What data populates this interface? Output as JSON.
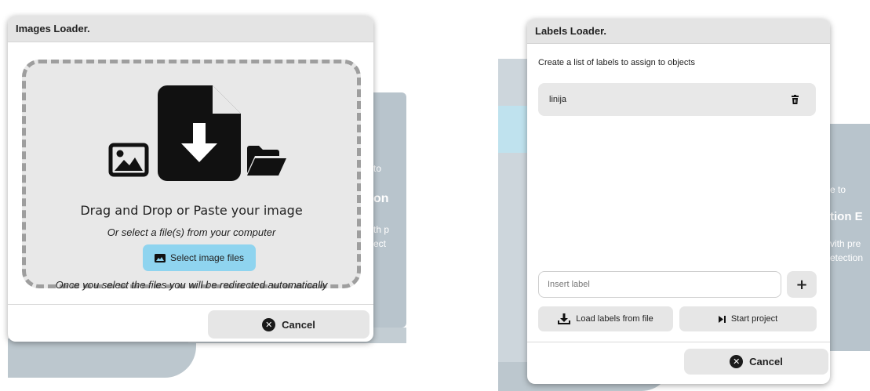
{
  "background": {
    "left_snippets": [
      "to",
      "on",
      "th p",
      "ect"
    ],
    "right_snippets": [
      "e to",
      "tion E",
      "vith pre",
      "etection"
    ]
  },
  "images_loader": {
    "title": "Images Loader.",
    "drop_title": "Drag and Drop or Paste your image",
    "drop_subtitle": "Or select a file(s) from your computer",
    "select_label": "Select image files",
    "note": "Once you select the files you will be redirected automatically",
    "cancel_label": "Cancel"
  },
  "labels_loader": {
    "title": "Labels Loader.",
    "description": "Create a list of labels to assign to objects",
    "labels": [
      "linija"
    ],
    "insert_placeholder": "Insert label",
    "add_label": "+",
    "load_label": "Load labels from file",
    "start_label": "Start project",
    "cancel_label": "Cancel"
  },
  "colors": {
    "select_button": "#8fd4ef",
    "dialog_header": "#e4e4e4",
    "background_block": "#b8c4cc"
  }
}
